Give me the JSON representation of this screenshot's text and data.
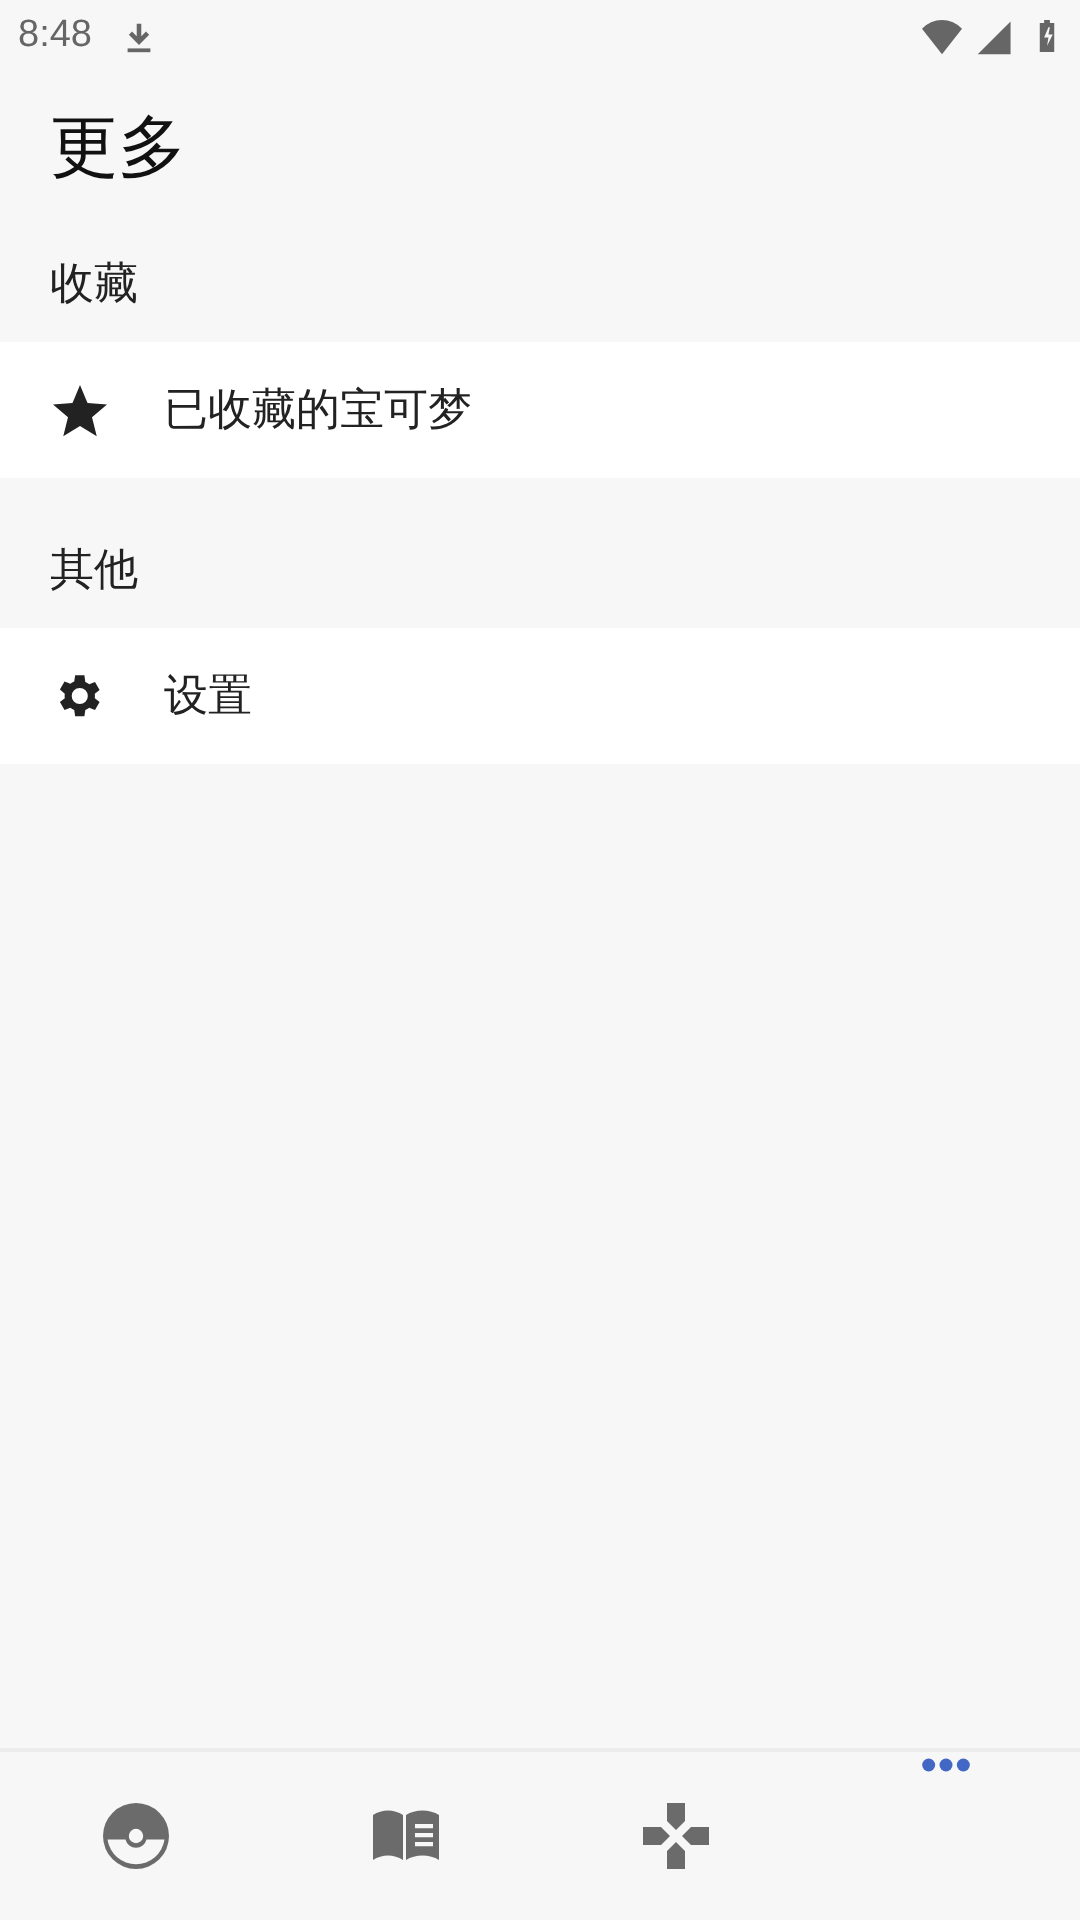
{
  "status_bar": {
    "time": "8:48"
  },
  "title": "更多",
  "sections": [
    {
      "header": "收藏",
      "items": [
        {
          "kind": "star",
          "label": "已收藏的宝可梦"
        }
      ]
    },
    {
      "header": "其他",
      "items": [
        {
          "kind": "gear",
          "label": "设置"
        }
      ]
    }
  ],
  "bottom_nav": [
    {
      "kind": "ball",
      "selected": false
    },
    {
      "kind": "book",
      "selected": false
    },
    {
      "kind": "dpad",
      "selected": false
    },
    {
      "kind": "more",
      "selected": true
    }
  ]
}
